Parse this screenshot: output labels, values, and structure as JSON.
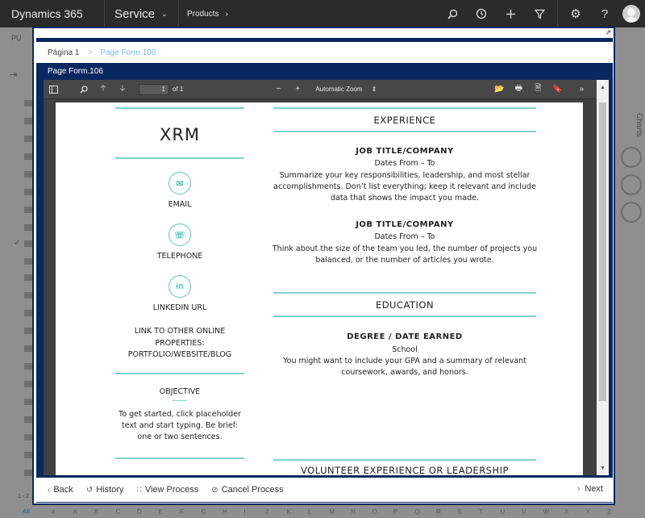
{
  "topbar": {
    "brand": "Dynamics 365",
    "area": "Service",
    "breadcrumb": "Products",
    "icons": [
      "search-icon",
      "history-icon",
      "plus-icon",
      "filter-icon",
      "gear-icon",
      "help-icon",
      "avatar"
    ]
  },
  "background": {
    "toolbar_hint": "PU",
    "count_hint": "1 - 2",
    "charts_label": "Charts",
    "alphabet": [
      "All",
      "#",
      "A",
      "B",
      "C",
      "D",
      "E",
      "F",
      "G",
      "H",
      "I",
      "J",
      "K",
      "L",
      "M",
      "N",
      "O",
      "P",
      "Q",
      "R",
      "S",
      "T",
      "U",
      "V",
      "W",
      "X",
      "Y",
      "Z"
    ]
  },
  "dialog": {
    "breadcrumb_root": "Página 1",
    "breadcrumb_sep": ">",
    "breadcrumb_current": "Page Form.106",
    "form_title": "Page Form.106"
  },
  "pdf_toolbar": {
    "page_number": "1",
    "page_of": "of 1",
    "zoom": "Automatic Zoom",
    "zoom_arrow": "⇕",
    "zoom_minus": "−",
    "zoom_plus": "+"
  },
  "resume": {
    "name": "XRM",
    "email": "EMAIL",
    "telephone": "TELEPHONE",
    "linkedin": "LINKEDIN URL",
    "link_line1": "LINK TO OTHER ONLINE",
    "link_line2": "PROPERTIES:",
    "link_line3": "PORTFOLIO/WEBSITE/BLOG",
    "objective_title": "OBJECTIVE",
    "objective_line1": "To get started, click placeholder",
    "objective_line2": "text and start typing. Be brief:",
    "objective_line3": "one or two sentences.",
    "experience_title": "EXPERIENCE",
    "job1_title": "JOB TITLE/COMPANY",
    "job1_dates": "Dates From – To",
    "job1_line1": "Summarize your key responsibilities, leadership, and most stellar",
    "job1_line2": "accomplishments. Don’t list everything; keep it relevant and include",
    "job1_line3": "data that shows the impact you made.",
    "job2_title": "JOB TITLE/COMPANY",
    "job2_dates": "Dates From – To",
    "job2_line1": "Think about the size of the team you led, the number of projects you",
    "job2_line2": "balanced, or the number of articles you wrote.",
    "education_title": "EDUCATION",
    "degree_title": "DEGREE / DATE EARNED",
    "school": "School",
    "edu_line1": "You might want to include your GPA and a summary of relevant",
    "edu_line2": "coursework, awards, and honors.",
    "volunteer_title": "VOLUNTEER EXPERIENCE OR LEADERSHIP"
  },
  "footer": {
    "back": "Back",
    "history": "History",
    "view_process": "View Process",
    "cancel_process": "Cancel Process",
    "next": "Next"
  }
}
